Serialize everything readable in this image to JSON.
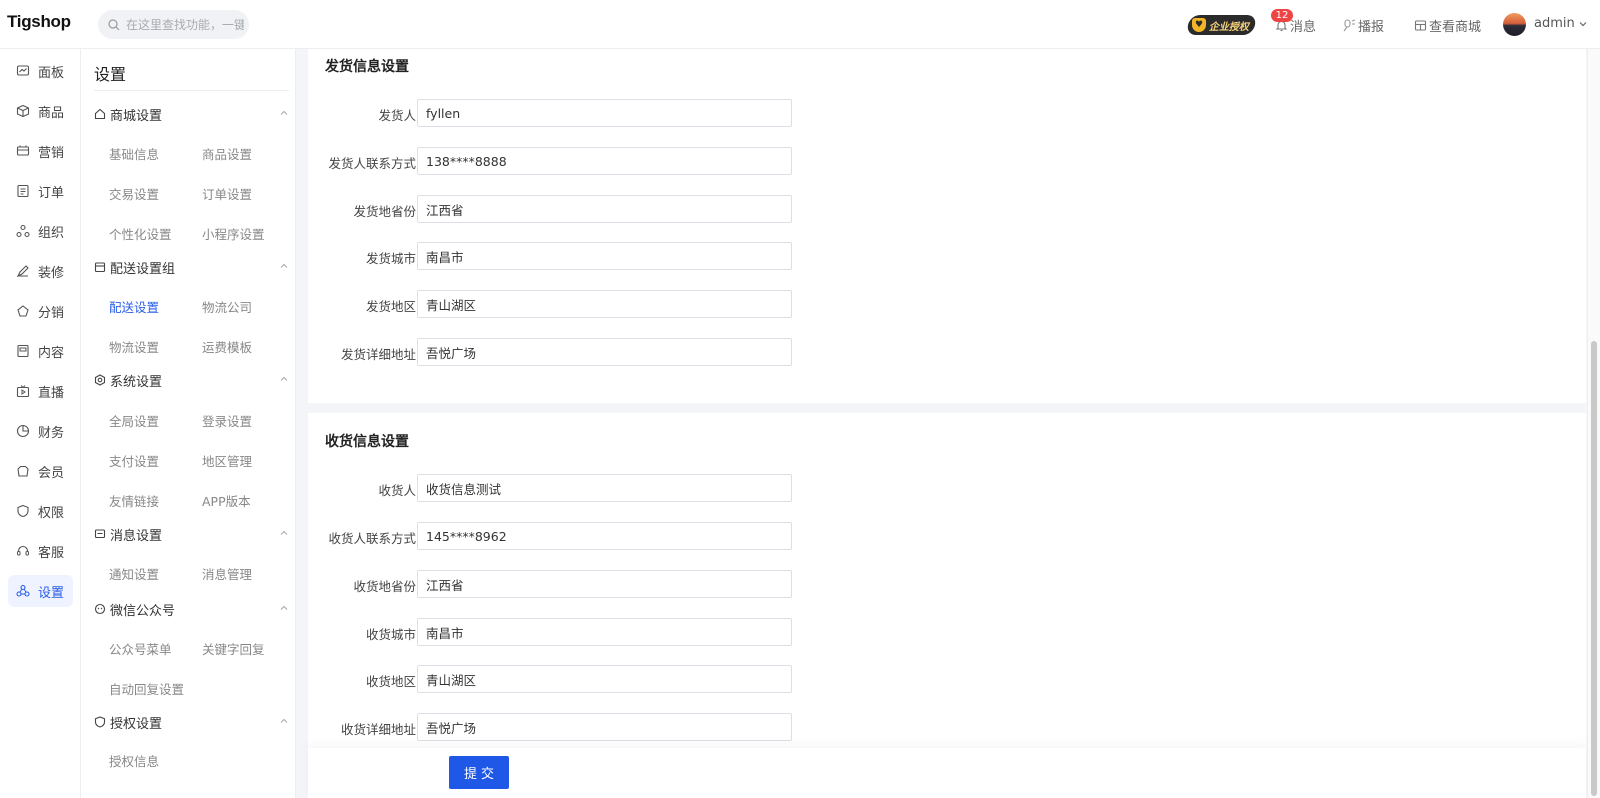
{
  "header": {
    "logo_text": "Tigshop",
    "search_placeholder": "在这里查找功能，一键直达",
    "auth_label": "企业授权",
    "message_label": "消息",
    "message_count": "12",
    "broadcast_label": "播报",
    "view_store_label": "查看商城",
    "user_name": "admin"
  },
  "nav": {
    "items": [
      {
        "label": "面板",
        "icon": "dashboard-icon"
      },
      {
        "label": "商品",
        "icon": "box-icon"
      },
      {
        "label": "营销",
        "icon": "marketing-icon"
      },
      {
        "label": "订单",
        "icon": "order-icon"
      },
      {
        "label": "组织",
        "icon": "org-icon"
      },
      {
        "label": "装修",
        "icon": "decorate-icon"
      },
      {
        "label": "分销",
        "icon": "distribution-icon"
      },
      {
        "label": "内容",
        "icon": "content-icon"
      },
      {
        "label": "直播",
        "icon": "live-icon"
      },
      {
        "label": "财务",
        "icon": "finance-icon"
      },
      {
        "label": "会员",
        "icon": "member-icon"
      },
      {
        "label": "权限",
        "icon": "permission-icon"
      },
      {
        "label": "客服",
        "icon": "service-icon"
      },
      {
        "label": "设置",
        "icon": "settings-icon"
      }
    ],
    "active": "设置"
  },
  "submenu": {
    "title": "设置",
    "groups": [
      {
        "label": "商城设置",
        "links": [
          "基础信息",
          "商品设置",
          "交易设置",
          "订单设置",
          "个性化设置",
          "小程序设置"
        ]
      },
      {
        "label": "配送设置组",
        "links": [
          "配送设置",
          "物流公司",
          "物流设置",
          "运费模板"
        ]
      },
      {
        "label": "系统设置",
        "links": [
          "全局设置",
          "登录设置",
          "支付设置",
          "地区管理",
          "友情链接",
          "APP版本"
        ]
      },
      {
        "label": "消息设置",
        "links": [
          "通知设置",
          "消息管理"
        ]
      },
      {
        "label": "微信公众号",
        "links": [
          "公众号菜单",
          "关键字回复",
          "自动回复设置"
        ]
      },
      {
        "label": "授权设置",
        "links": [
          "授权信息"
        ]
      }
    ],
    "active_link": "配送设置"
  },
  "shipping": {
    "title": "发货信息设置",
    "fields": [
      {
        "label": "发货人",
        "value": "fyllen"
      },
      {
        "label": "发货人联系方式",
        "value": "138****8888"
      },
      {
        "label": "发货地省份",
        "value": "江西省"
      },
      {
        "label": "发货城市",
        "value": "南昌市"
      },
      {
        "label": "发货地区",
        "value": "青山湖区"
      },
      {
        "label": "发货详细地址",
        "value": "吾悦广场"
      }
    ]
  },
  "receiving": {
    "title": "收货信息设置",
    "fields": [
      {
        "label": "收货人",
        "value": "收货信息测试"
      },
      {
        "label": "收货人联系方式",
        "value": "145****8962"
      },
      {
        "label": "收货地省份",
        "value": "江西省"
      },
      {
        "label": "收货城市",
        "value": "南昌市"
      },
      {
        "label": "收货地区",
        "value": "青山湖区"
      },
      {
        "label": "收货详细地址",
        "value": "吾悦广场"
      }
    ]
  },
  "actions": {
    "submit_label": "提交"
  },
  "colors": {
    "primary": "#1f57e7",
    "active_bg": "#eef3ff",
    "badge": "#ef4444"
  }
}
